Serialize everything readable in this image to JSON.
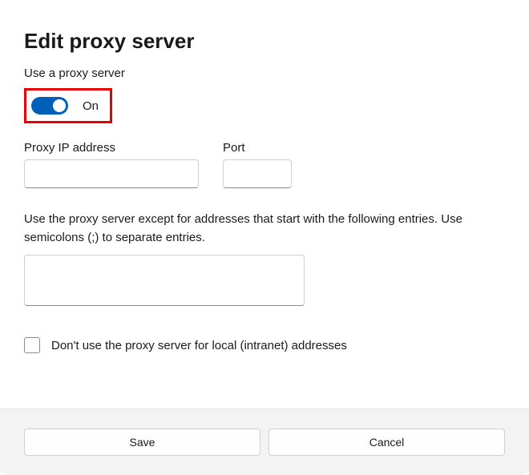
{
  "dialog": {
    "title": "Edit proxy server",
    "subtitle": "Use a proxy server",
    "toggle": {
      "state": "on",
      "label": "On"
    },
    "fields": {
      "ip": {
        "label": "Proxy IP address",
        "value": ""
      },
      "port": {
        "label": "Port",
        "value": ""
      }
    },
    "exceptions": {
      "description": "Use the proxy server except for addresses that start with the following entries. Use semicolons (;) to separate entries.",
      "value": ""
    },
    "bypass_local": {
      "checked": false,
      "label": "Don't use the proxy server for local (intranet) addresses"
    },
    "buttons": {
      "save": "Save",
      "cancel": "Cancel"
    }
  },
  "annotation": {
    "highlight_color": "#e60000"
  }
}
